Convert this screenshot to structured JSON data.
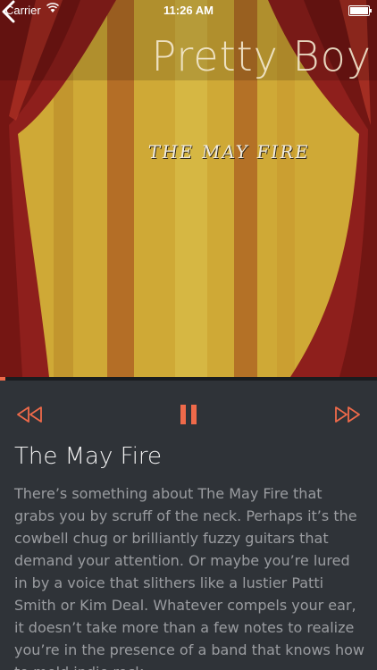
{
  "status": {
    "carrier": "Carrier",
    "time": "11:26 AM"
  },
  "header": {
    "song_title": "Pretty Boy"
  },
  "artwork": {
    "band_logo": "THE MAY FIRE"
  },
  "player": {
    "progress": 0.014
  },
  "album": {
    "title": "The May Fire",
    "description": "There’s something about The May Fire that grabs you by scruff of the neck. Perhaps it’s  the cowbell chug or brilliantly fuzzy guitars that demand your attention. Or maybe  you’re lured in by a voice that slithers like a lustier Patti Smith or Kim Deal. Whatever  compels your ear, it doesn’t take more than a few notes to realize you’re in the  presence of a band that knows how to meld indie rock,"
  },
  "colors": {
    "accent": "#ef6a4a",
    "background": "#2f3338"
  }
}
